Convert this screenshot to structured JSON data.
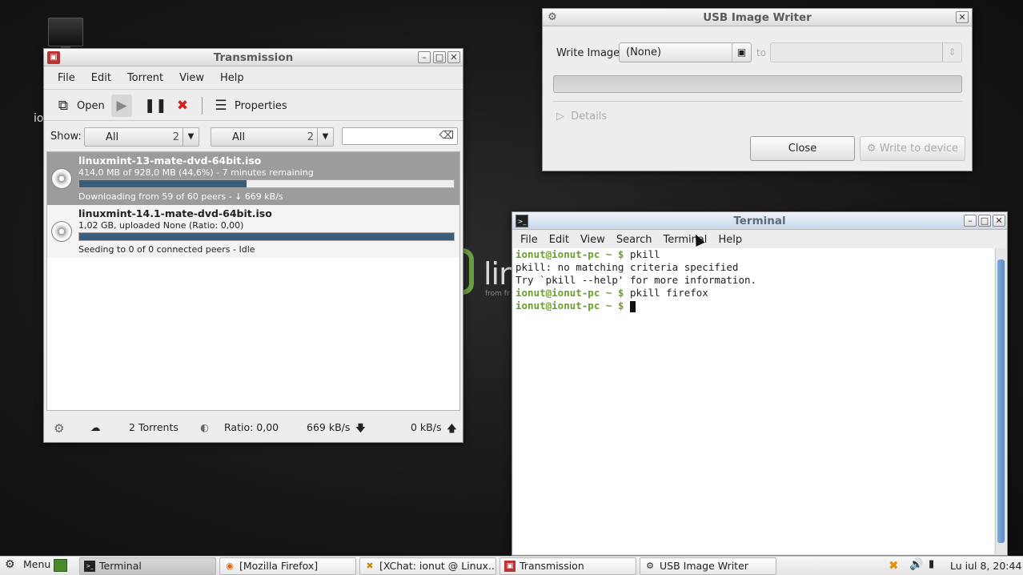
{
  "desktop": {
    "partial_label": "io"
  },
  "transmission": {
    "title": "Transmission",
    "menu": [
      "File",
      "Edit",
      "Torrent",
      "View",
      "Help"
    ],
    "toolbar": {
      "open": "Open",
      "properties": "Properties"
    },
    "filter": {
      "show_label": "Show:",
      "combo1": {
        "label": "All",
        "count": "2"
      },
      "combo2": {
        "label": "All",
        "count": "2"
      },
      "search_value": ""
    },
    "torrents": [
      {
        "name": "linuxmint-13-mate-dvd-64bit.iso",
        "sub": "414,0 MB of 928,0 MB (44,6%) - 7 minutes remaining",
        "progress": 44.6,
        "status": "Downloading from 59 of 60 peers - ↓ 669 kB/s"
      },
      {
        "name": "linuxmint-14.1-mate-dvd-64bit.iso",
        "sub": "1,02 GB, uploaded None (Ratio: 0,00)",
        "progress": 100,
        "status": "Seeding to 0 of 0 connected peers - Idle"
      }
    ],
    "status": {
      "torrents": "2 Torrents",
      "ratio": "Ratio: 0,00",
      "down": "669 kB/s",
      "up": "0 kB/s"
    }
  },
  "usb": {
    "title": "USB Image Writer",
    "write_label": "Write Image:",
    "image_value": "(None)",
    "to_label": "to",
    "details": "Details",
    "close": "Close",
    "write_device": "Write to device"
  },
  "terminal": {
    "title": "Terminal",
    "menu": [
      "File",
      "Edit",
      "View",
      "Search",
      "Terminal",
      "Help"
    ],
    "prompt": "ionut@ionut-pc ~ $",
    "lines": {
      "cmd1": "pkill",
      "out1": "pkill: no matching criteria specified",
      "out2": "Try `pkill --help' for more information.",
      "cmd2": "pkill firefox"
    }
  },
  "panel": {
    "menu": "Menu",
    "tasks": [
      "Terminal",
      "[Mozilla Firefox]",
      "[XChat: ionut @ Linux...",
      "Transmission",
      "USB Image Writer"
    ],
    "clock": "Lu iul  8, 20:44"
  }
}
